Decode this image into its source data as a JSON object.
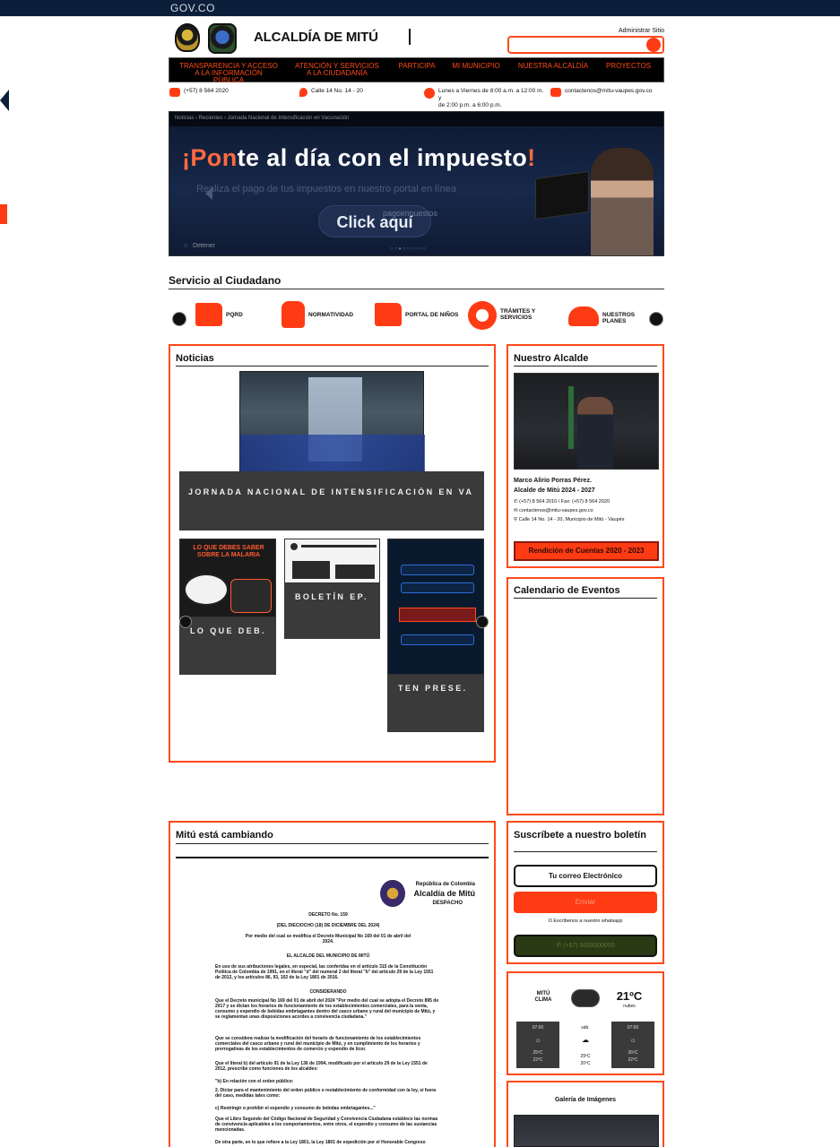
{
  "gov_bar": {
    "brand": "GOV.CO"
  },
  "header": {
    "site_title": "ALCALDÍA DE MITÚ",
    "admin_link": "Administrar Sitio",
    "search_placeholder": ""
  },
  "nav": [
    {
      "line1": "TRANSPARENCIA Y ACCESO",
      "line2": "A LA INFORMACIÓN PÚBLICA"
    },
    {
      "line1": "ATENCIÓN Y SERVICIOS",
      "line2": "A LA CIUDADANÍA"
    },
    {
      "line1": "PARTICIPA",
      "line2": ""
    },
    {
      "line1": "MI MUNICIPIO",
      "line2": ""
    },
    {
      "line1": "NUESTRA ALCALDÍA",
      "line2": ""
    },
    {
      "line1": "PROYECTOS",
      "line2": ""
    }
  ],
  "contact": {
    "phone": "(+57) 8 564 2020",
    "address": "Calle 14 No. 14 - 20",
    "hours_line1": "Lunes a Viernes de 8:00 a.m. a 12:00 m. y",
    "hours_line2": "de 2:00 p.m. a 6:00 p.m.",
    "email": "contactenos@mitu-vaupes.gov.co"
  },
  "hero": {
    "breadcrumb": "Noticias › Recientes › Jornada Nacional de Intensificación en Vacunación",
    "title_accent": "¡Pon",
    "title_rest": "te al día con el impuesto",
    "title_end": "!",
    "subtitle": "Realiza el pago de tus impuestos en nuestro portal en línea",
    "url_text": "pagoimpuestos",
    "cta": "Click aquí",
    "pause": "Detener",
    "dots": "○○●○○○○○○"
  },
  "servicio": {
    "title": "Servicio al Ciudadano",
    "items": [
      {
        "label1": "PQRD",
        "label2": "",
        "icon": "folder-icon"
      },
      {
        "label1": "NORMATIVIDAD",
        "label2": "",
        "icon": "hand-icon"
      },
      {
        "label1": "PORTAL DE NIÑOS",
        "label2": "",
        "icon": "folder-icon"
      },
      {
        "label1": "TRÁMITES Y",
        "label2": "SERVICIOS",
        "icon": "gears-icon"
      },
      {
        "label1": "NUESTROS PLANES",
        "label2": "",
        "icon": "people-icon"
      }
    ]
  },
  "noticias": {
    "title": "Noticias",
    "main_caption": "JORNADA NACIONAL DE INTENSIFICACIÓN EN VA",
    "cards": [
      {
        "caption": "LO QUE DEB.",
        "headline": "LO QUE DEBES SABER SOBRE LA MALARIA"
      },
      {
        "caption": "BOLETÍN EP.",
        "headline": ""
      },
      {
        "caption": "TEN PRESE.",
        "headline": ""
      }
    ]
  },
  "alcalde": {
    "title": "Nuestro Alcalde",
    "name": "Marco Alirio Porras Pérez.",
    "role": "Alcalde de Mitú 2024 - 2027",
    "phone": "(+57) 8 564 2010 / Fax: (+57) 8 564 2020",
    "email": "contactenos@mitu-vaupes.gov.co",
    "address": "Calle 14 No. 14 - 20, Municipio de Mitú - Vaupés",
    "button": "Rendición de Cuentas 2020 - 2023"
  },
  "calendario": {
    "title": "Calendario de Eventos"
  },
  "cambiando": {
    "title": "Mitú está cambiando",
    "doc": {
      "header1": "República de Colombia",
      "header2": "Alcaldía de Mitú",
      "header3": "DESPACHO",
      "decree": "DECRETO No. 159",
      "date": "(DEL DIECIOCHO (18) DE DICIEMBRE DEL 2024)",
      "subject1": "Por medio del cual se modifica el Decreto Municipal No 169 del 01 de abril del",
      "subject2": "2024.",
      "issuer": "EL ALCALDE DEL MUNICIPIO DE MITÚ",
      "para1": "En uso de sus atribuciones legales, en especial, las conferidas en el artículo 315 de la Constitución Política de Colombia de 1991, en el literal \"d\" del numeral 2 del literal \"b\" del artículo 29 de la Ley 1551 de 2012, y los artículos 86, 93, 102 de la Ley 1801 de 2016.",
      "considerando": "CONSIDERANDO",
      "para2": "Que el Decreto municipal No 169 del 01 de abril del 2024 \"Por medio del cual se adopta el Decreto 895 de 2017 y se dictan los horarios de funcionamiento de los establecimientos comerciales, para la venta, consumo y expendio de bebidas embriagantes dentro del casco urbano y rural del municipio de Mitú, y se reglamentan unas disposiciones acordes a convivencia ciudadana.\"",
      "para3": "Que se considera realizar la modificación del horario de funcionamiento de los establecimientos comerciales del casco urbano y rural del municipio de Mitú, y en cumplimiento de los horarios y prerrogativas de los establecimientos de comercio y expendio de licor.",
      "para4": "Que el literal b) del artículo 91 de la Ley 136 de 1994, modificado por el artículo 29 de la Ley 1551 de 2012, prescribe como funciones de los alcaldes:",
      "para5": "\"b) En relación con el orden público:",
      "para6": "2. Dictar para el mantenimiento del orden público o restablecimiento de conformidad con la ley, si fuera del caso, medidas tales como:",
      "para7": "c) Restringir o prohibir el expendio y consumo de bebidas embriagantes...\"",
      "para8": "Que el Libro Segundo del Código Nacional de Seguridad y Convivencia Ciudadana establece las normas de convivencia aplicables a los comportamientos, entre otros, el expendio y consumo de las sustancias mencionadas.",
      "para9": "De otra parte, en lo que refiere a la Ley 1801, la Ley 1801 de expedición por el Honorable Congreso"
    }
  },
  "boletin": {
    "title": "Suscríbete a nuestro boletín",
    "email_placeholder": "Tu correo Electrónico",
    "submit": "Enviar",
    "whatsapp_text": "O Escríbenos a nuestro whatsapp",
    "whatsapp_button": "(+57) 3000000000"
  },
  "clima": {
    "city1": "MITÚ",
    "city2": "CLIMA",
    "temp": "21ºC",
    "desc": "nubes",
    "day_label": "sáb.",
    "col_left": [
      "07:00",
      "☼",
      "25ºC",
      "22ºC"
    ],
    "col_mid": [
      "29ºC",
      "20ºC"
    ],
    "col_right": [
      "07:00",
      "☼",
      "26ºC",
      "22ºC"
    ]
  },
  "galeria": {
    "title": "Galería de Imágenes"
  },
  "colors": {
    "accent": "#ff3b14",
    "navbar_bg": "#000000",
    "gov_bg": "#0b1f3a"
  }
}
